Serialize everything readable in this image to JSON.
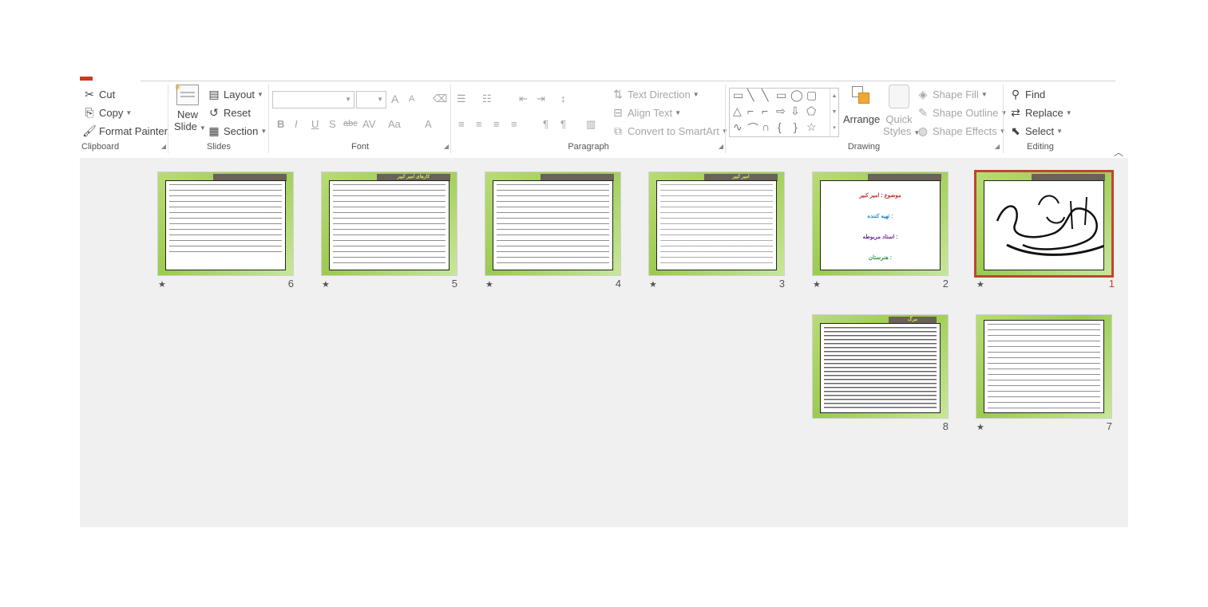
{
  "ribbon": {
    "clipboard": {
      "cut": "Cut",
      "copy": "Copy",
      "format_painter": "Format Painter",
      "label": "Clipboard"
    },
    "slides": {
      "new_slide_1": "New",
      "new_slide_2": "Slide",
      "layout": "Layout",
      "reset": "Reset",
      "section": "Section",
      "label": "Slides"
    },
    "font": {
      "label": "Font",
      "bold": "B",
      "italic": "I",
      "underline": "U",
      "shadow": "S",
      "strike": "abc",
      "spacing": "AV",
      "case": "Aa",
      "color": "A",
      "grow": "A",
      "shrink": "A"
    },
    "paragraph": {
      "label": "Paragraph",
      "text_direction": "Text Direction",
      "align_text": "Align Text",
      "convert_smartart": "Convert to SmartArt"
    },
    "drawing": {
      "label": "Drawing",
      "arrange": "Arrange",
      "quick_styles_1": "Quick",
      "quick_styles_2": "Styles",
      "shape_fill": "Shape Fill",
      "shape_outline": "Shape Outline",
      "shape_effects": "Shape Effects"
    },
    "editing": {
      "label": "Editing",
      "find": "Find",
      "replace": "Replace",
      "select": "Select"
    }
  },
  "slides": [
    {
      "number": "1",
      "selected": true,
      "star": "★"
    },
    {
      "number": "2",
      "selected": false,
      "star": "★",
      "lines": [
        "موضوع : امیر کبیر",
        "تهیه کننده :",
        "استاد مربوطه :",
        "هنرستان :"
      ]
    },
    {
      "number": "3",
      "selected": false,
      "star": "★",
      "title": "امیر کبیر"
    },
    {
      "number": "4",
      "selected": false,
      "star": "★"
    },
    {
      "number": "5",
      "selected": false,
      "star": "★",
      "title": "کارهای امیر کبیر"
    },
    {
      "number": "6",
      "selected": false,
      "star": "★"
    },
    {
      "number": "7",
      "selected": false,
      "star": "★"
    },
    {
      "number": "8",
      "selected": false,
      "star": "",
      "title": "مرگ"
    }
  ],
  "colors": {
    "accent": "#c0452e",
    "slide_bg": "#a9d05c",
    "tab": "#6a6257"
  }
}
